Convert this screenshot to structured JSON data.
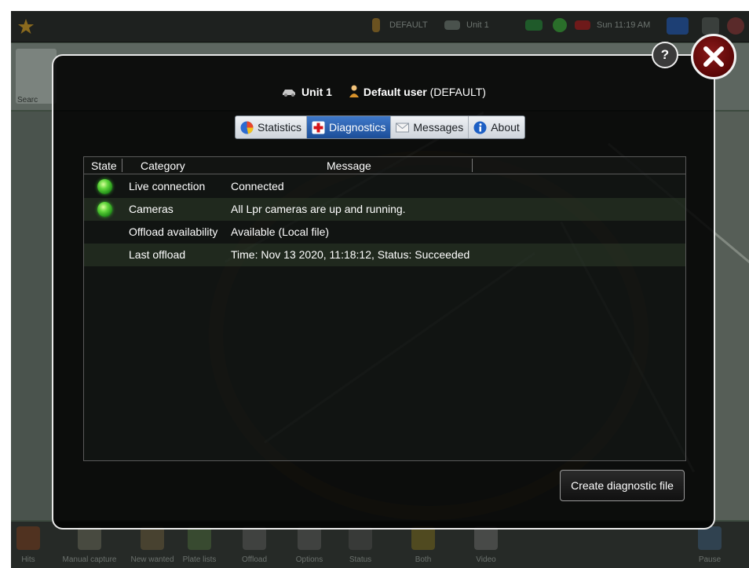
{
  "topbar": {
    "user": "DEFAULT",
    "unit": "Unit 1",
    "clock": "Sun 11:19 AM",
    "help": "?"
  },
  "background": {
    "search_label": "Searc",
    "bottom_buttons": [
      {
        "label": "Hits",
        "icon": "target-icon"
      },
      {
        "label": "Manual capture",
        "icon": "keyboard-icon"
      },
      {
        "label": "New wanted",
        "icon": "wanted-icon"
      },
      {
        "label": "Plate lists",
        "icon": "plate-list-icon"
      },
      {
        "label": "Offload",
        "icon": "offload-icon"
      },
      {
        "label": "Options",
        "icon": "options-icon"
      },
      {
        "label": "Status",
        "icon": "status-icon"
      },
      {
        "label": "Both",
        "icon": "both-arrows-icon"
      },
      {
        "label": "Video",
        "icon": "video-icon"
      },
      {
        "label": "Pause",
        "icon": "pause-icon"
      }
    ]
  },
  "dialog": {
    "unit_name": "Unit 1",
    "user_name": "Default user",
    "user_id": "(DEFAULT)",
    "tabs": [
      {
        "label": "Statistics",
        "icon": "pie-chart-icon",
        "active": false
      },
      {
        "label": "Diagnostics",
        "icon": "first-aid-icon",
        "active": true
      },
      {
        "label": "Messages",
        "icon": "envelope-icon",
        "active": false
      },
      {
        "label": "About",
        "icon": "info-icon",
        "active": false
      }
    ],
    "columns": {
      "state": "State",
      "category": "Category",
      "message": "Message"
    },
    "rows": [
      {
        "state": "ok",
        "category": "Live connection",
        "message": "Connected"
      },
      {
        "state": "ok",
        "category": "Cameras",
        "message": "All Lpr cameras are up and running."
      },
      {
        "state": "",
        "category": "Offload availability",
        "message": "Available (Local file)"
      },
      {
        "state": "",
        "category": "Last offload",
        "message": "Time: Nov 13 2020, 11:18:12, Status: Succeeded"
      }
    ],
    "create_button": "Create diagnostic file",
    "help_button": "?"
  },
  "colors": {
    "accent_tab": "#1c4e98",
    "led_green": "#5ed43a",
    "close_red": "#5a0606"
  }
}
